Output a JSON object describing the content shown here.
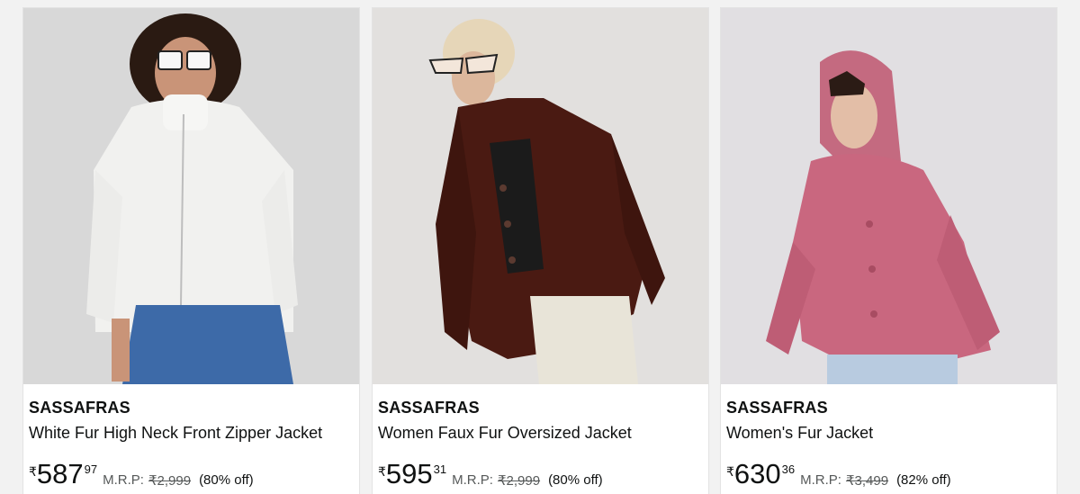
{
  "products": [
    {
      "brand": "SASSAFRAS",
      "title": "White Fur High Neck Front Zipper Jacket",
      "currency": "₹",
      "price_whole": "587",
      "price_fraction": "97",
      "mrp_label": "M.R.P:",
      "mrp": "₹2,999",
      "discount": "(80% off)",
      "jacket_color": "#f1f1ef",
      "image_icon": "product-photo-white-fur-jacket"
    },
    {
      "brand": "SASSAFRAS",
      "title": "Women Faux Fur Oversized Jacket",
      "currency": "₹",
      "price_whole": "595",
      "price_fraction": "31",
      "mrp_label": "M.R.P:",
      "mrp": "₹2,999",
      "discount": "(80% off)",
      "jacket_color": "#4a1a12",
      "image_icon": "product-photo-brown-fur-jacket"
    },
    {
      "brand": "SASSAFRAS",
      "title": "Women's Fur Jacket",
      "currency": "₹",
      "price_whole": "630",
      "price_fraction": "36",
      "mrp_label": "M.R.P:",
      "mrp": "₹3,499",
      "discount": "(82% off)",
      "jacket_color": "#c9677f",
      "image_icon": "product-photo-pink-fur-jacket"
    }
  ]
}
